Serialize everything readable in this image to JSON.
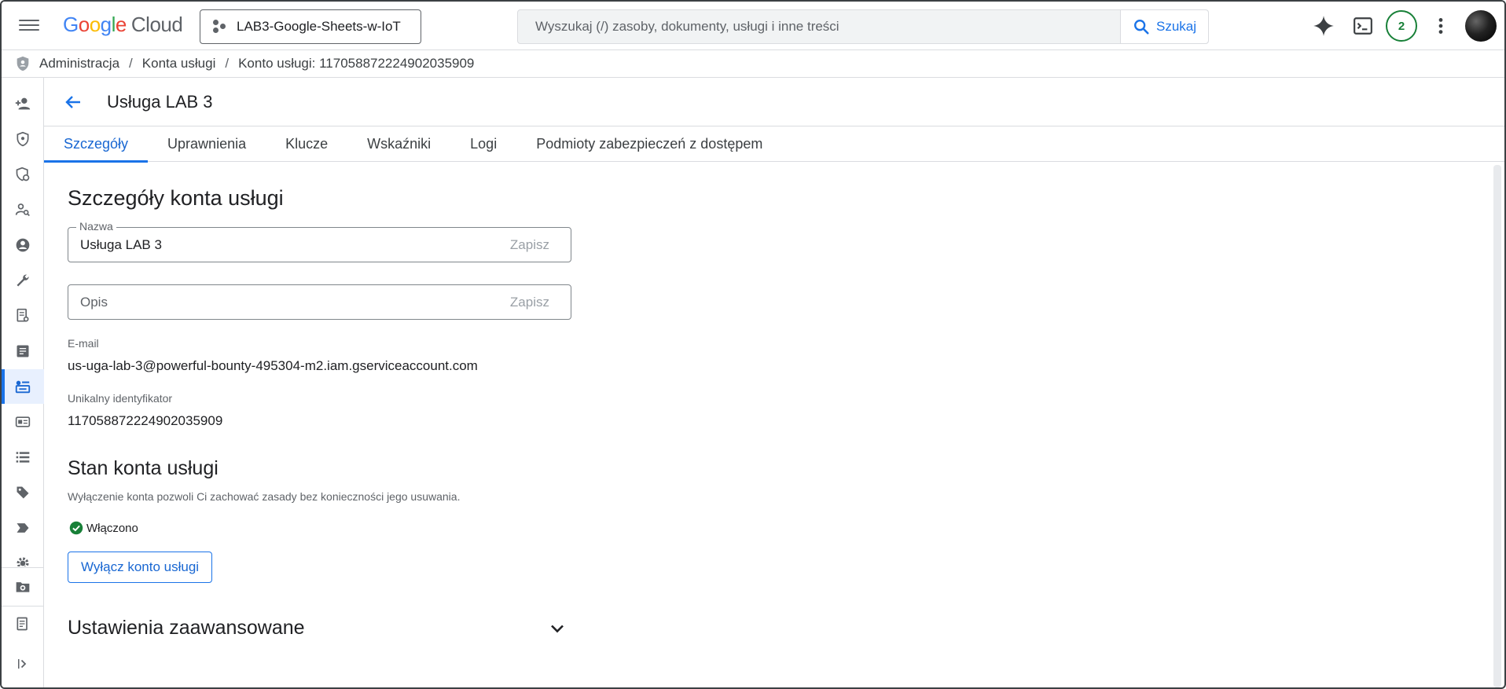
{
  "topbar": {
    "logo_google": "Google",
    "logo_cloud": "Cloud",
    "project_name": "LAB3-Google-Sheets-w-IoT",
    "search_placeholder": "Wyszukaj (/) zasoby, dokumenty, usługi i inne treści",
    "search_button": "Szukaj",
    "notifications_count": "2"
  },
  "breadcrumb": {
    "items": [
      "Administracja",
      "Konta usługi",
      "Konto usługi: 117058872224902035909"
    ]
  },
  "rail": {
    "icons": [
      "person-add-icon",
      "shield-icon",
      "policy-icon",
      "person-search-icon",
      "account-circle-icon",
      "wrench-icon",
      "audit-icon",
      "note-icon",
      "service-account-icon",
      "id-card-icon",
      "list-icon",
      "tag-icon",
      "label-icon",
      "gear-icon",
      "folder-gear-icon",
      "release-notes-icon",
      "collapse-icon"
    ],
    "active_index": 8
  },
  "page": {
    "title": "Usługa LAB 3",
    "tabs": [
      {
        "label": "Szczegóły",
        "active": true
      },
      {
        "label": "Uprawnienia",
        "active": false
      },
      {
        "label": "Klucze",
        "active": false
      },
      {
        "label": "Wskaźniki",
        "active": false
      },
      {
        "label": "Logi",
        "active": false
      },
      {
        "label": "Podmioty zabezpieczeń z dostępem",
        "active": false
      }
    ]
  },
  "details": {
    "heading": "Szczegóły konta usługi",
    "name_label": "Nazwa",
    "name_value": "Usługa LAB 3",
    "save_label": "Zapisz",
    "description_placeholder": "Opis",
    "email_label": "E-mail",
    "email_value": "us-uga-lab-3@powerful-bounty-495304-m2.iam.gserviceaccount.com",
    "unique_id_label": "Unikalny identyfikator",
    "unique_id_value": "117058872224902035909"
  },
  "status_section": {
    "heading": "Stan konta usługi",
    "description": "Wyłączenie konta pozwoli Ci zachować zasady bez konieczności jego usuwania.",
    "status_text": "Włączono",
    "disable_button": "Wyłącz konto usługi"
  },
  "advanced": {
    "heading": "Ustawienia zaawansowane"
  },
  "colors": {
    "accent": "#1a73e8",
    "success": "#188038"
  }
}
